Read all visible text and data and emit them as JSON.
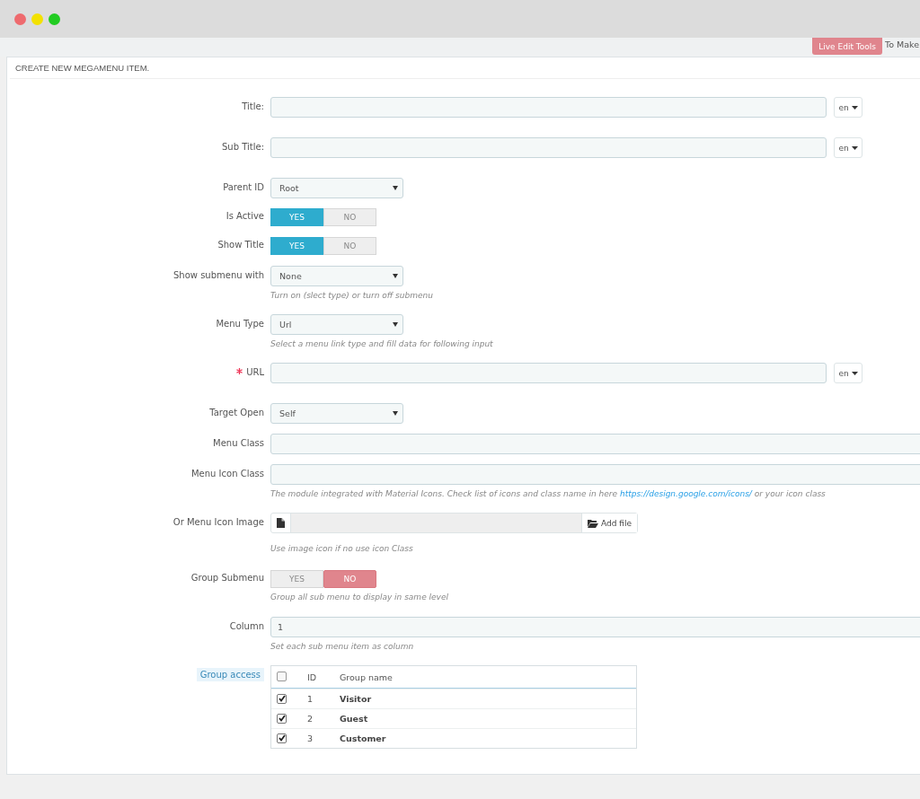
{
  "toolbar": {
    "button": "Live Edit Tools",
    "text": "To Make"
  },
  "panel": {
    "title": "CREATE NEW MEGAMENU ITEM.",
    "fields": [
      {
        "kind": "text",
        "label": "Title:",
        "lang": "en"
      },
      {
        "kind": "text",
        "label": "Sub Title:",
        "lang": "en"
      },
      {
        "kind": "select",
        "label": "Parent ID",
        "value": "Root"
      },
      {
        "kind": "toggle",
        "label": "Is Active",
        "options": [
          {
            "label": "YES",
            "selected": true
          },
          {
            "label": "NO",
            "selected": false
          }
        ]
      },
      {
        "kind": "toggle",
        "label": "Show Title",
        "options": [
          {
            "label": "YES",
            "selected": true
          },
          {
            "label": "NO",
            "selected": false
          }
        ]
      },
      {
        "kind": "select",
        "label": "Show submenu with",
        "value": "None",
        "help": "Turn on (slect type) or turn off submenu"
      },
      {
        "kind": "select",
        "label": "Menu Type",
        "value": "Url",
        "help": "Select a menu link type and fill data for following input"
      },
      {
        "kind": "text",
        "label": "URL",
        "required": true,
        "lang": "en"
      },
      {
        "kind": "select",
        "label": "Target Open",
        "value": "Self"
      },
      {
        "kind": "text",
        "label": "Menu Class"
      },
      {
        "kind": "text",
        "label": "Menu Icon Class",
        "help": "The module integrated with Material Icons. Check list of icons and class name in here",
        "link": "https://design.google.com/icons/",
        "help_after": "or your icon class"
      },
      {
        "kind": "file",
        "label": "Or Menu Icon Image",
        "button": "Add file",
        "help": "Use image icon if no use icon Class"
      },
      {
        "kind": "toggle",
        "label": "Group Submenu",
        "options": [
          {
            "label": "YES",
            "selected": false
          },
          {
            "label": "NO",
            "selected": true
          }
        ],
        "help": "Group all sub menu to display in same level"
      },
      {
        "kind": "text",
        "label": "Column",
        "value": "1",
        "help": "Set each sub menu item as column"
      },
      {
        "kind": "table",
        "label": "Group access",
        "all_checked": false,
        "columns": [
          "ID",
          "Group name"
        ],
        "rows": [
          {
            "id": "1",
            "name": "Visitor",
            "checked": true
          },
          {
            "id": "2",
            "name": "Guest",
            "checked": true
          },
          {
            "id": "3",
            "name": "Customer",
            "checked": true
          }
        ]
      }
    ]
  }
}
